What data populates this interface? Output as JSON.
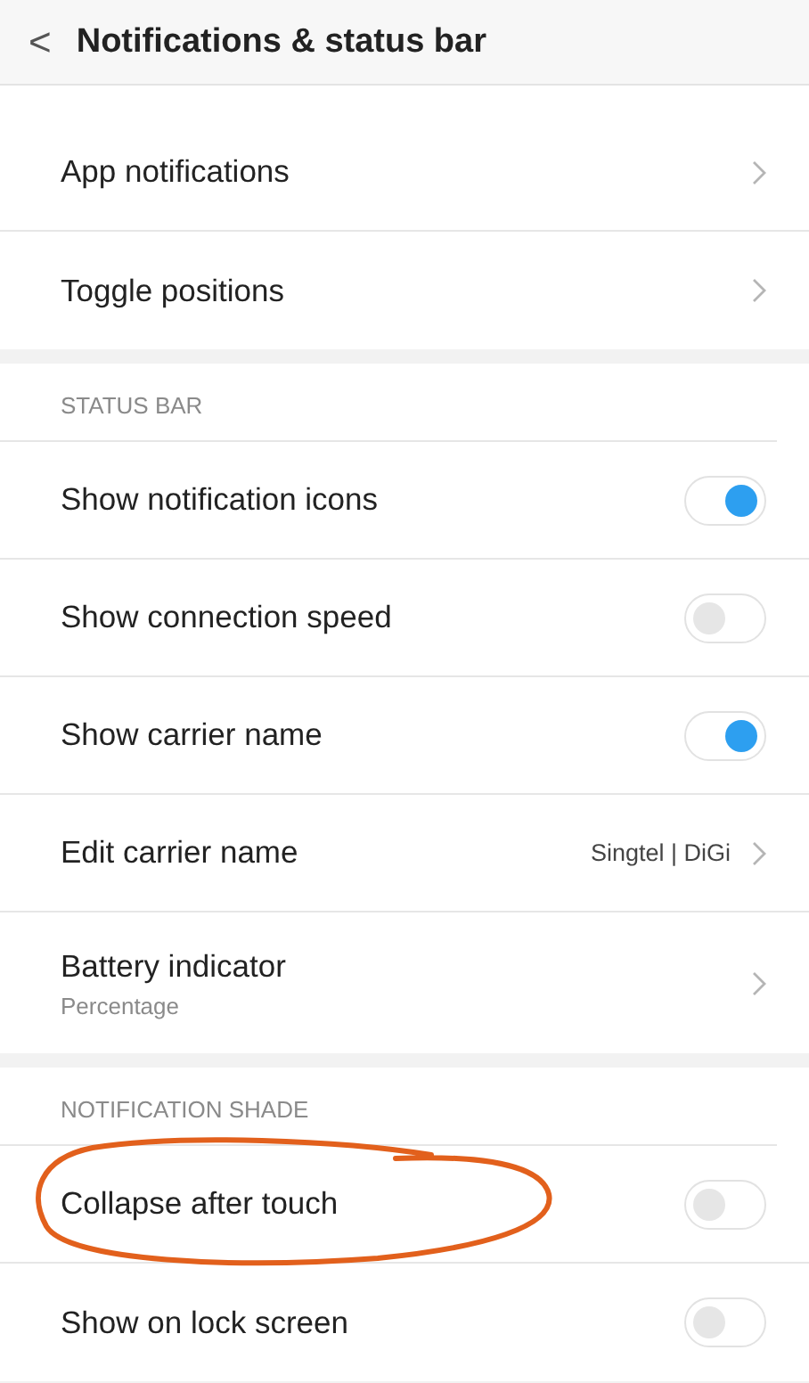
{
  "header": {
    "back": "<",
    "title": "Notifications & status bar"
  },
  "sections": [
    {
      "rows": [
        {
          "kind": "link",
          "label": "App notifications",
          "circled": false
        },
        {
          "kind": "link",
          "label": "Toggle positions",
          "circled": false
        }
      ]
    },
    {
      "heading": "STATUS BAR",
      "rows": [
        {
          "kind": "toggle",
          "label": "Show notification icons",
          "on": true,
          "circled": false
        },
        {
          "kind": "toggle",
          "label": "Show connection speed",
          "on": false,
          "circled": false
        },
        {
          "kind": "toggle",
          "label": "Show carrier name",
          "on": true,
          "circled": false
        },
        {
          "kind": "link",
          "label": "Edit carrier name",
          "value": "Singtel | DiGi",
          "circled": false
        },
        {
          "kind": "link",
          "label": "Battery indicator",
          "subtitle": "Percentage",
          "circled": false
        }
      ]
    },
    {
      "heading": "NOTIFICATION SHADE",
      "rows": [
        {
          "kind": "toggle",
          "label": "Collapse after touch",
          "on": false,
          "circled": true
        },
        {
          "kind": "toggle",
          "label": "Show on lock screen",
          "on": false,
          "circled": false
        }
      ]
    }
  ]
}
